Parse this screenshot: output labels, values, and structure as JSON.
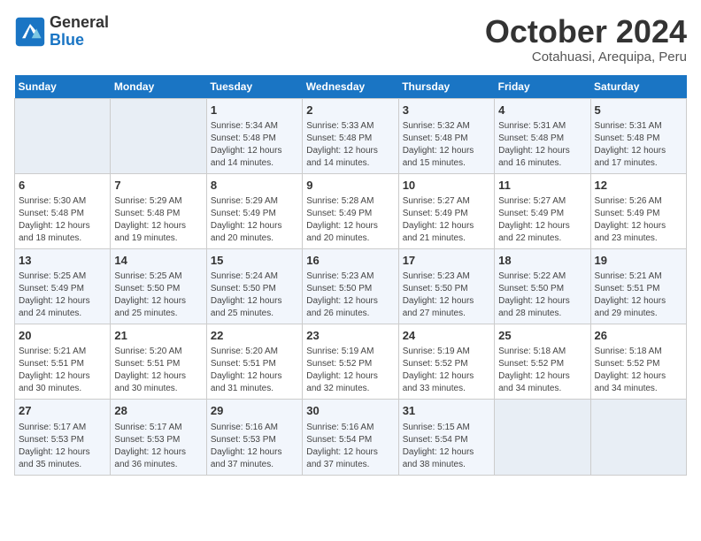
{
  "header": {
    "logo_line1": "General",
    "logo_line2": "Blue",
    "month": "October 2024",
    "location": "Cotahuasi, Arequipa, Peru"
  },
  "columns": [
    "Sunday",
    "Monday",
    "Tuesday",
    "Wednesday",
    "Thursday",
    "Friday",
    "Saturday"
  ],
  "weeks": [
    [
      {
        "num": "",
        "detail": ""
      },
      {
        "num": "",
        "detail": ""
      },
      {
        "num": "1",
        "detail": "Sunrise: 5:34 AM\nSunset: 5:48 PM\nDaylight: 12 hours\nand 14 minutes."
      },
      {
        "num": "2",
        "detail": "Sunrise: 5:33 AM\nSunset: 5:48 PM\nDaylight: 12 hours\nand 14 minutes."
      },
      {
        "num": "3",
        "detail": "Sunrise: 5:32 AM\nSunset: 5:48 PM\nDaylight: 12 hours\nand 15 minutes."
      },
      {
        "num": "4",
        "detail": "Sunrise: 5:31 AM\nSunset: 5:48 PM\nDaylight: 12 hours\nand 16 minutes."
      },
      {
        "num": "5",
        "detail": "Sunrise: 5:31 AM\nSunset: 5:48 PM\nDaylight: 12 hours\nand 17 minutes."
      }
    ],
    [
      {
        "num": "6",
        "detail": "Sunrise: 5:30 AM\nSunset: 5:48 PM\nDaylight: 12 hours\nand 18 minutes."
      },
      {
        "num": "7",
        "detail": "Sunrise: 5:29 AM\nSunset: 5:48 PM\nDaylight: 12 hours\nand 19 minutes."
      },
      {
        "num": "8",
        "detail": "Sunrise: 5:29 AM\nSunset: 5:49 PM\nDaylight: 12 hours\nand 20 minutes."
      },
      {
        "num": "9",
        "detail": "Sunrise: 5:28 AM\nSunset: 5:49 PM\nDaylight: 12 hours\nand 20 minutes."
      },
      {
        "num": "10",
        "detail": "Sunrise: 5:27 AM\nSunset: 5:49 PM\nDaylight: 12 hours\nand 21 minutes."
      },
      {
        "num": "11",
        "detail": "Sunrise: 5:27 AM\nSunset: 5:49 PM\nDaylight: 12 hours\nand 22 minutes."
      },
      {
        "num": "12",
        "detail": "Sunrise: 5:26 AM\nSunset: 5:49 PM\nDaylight: 12 hours\nand 23 minutes."
      }
    ],
    [
      {
        "num": "13",
        "detail": "Sunrise: 5:25 AM\nSunset: 5:49 PM\nDaylight: 12 hours\nand 24 minutes."
      },
      {
        "num": "14",
        "detail": "Sunrise: 5:25 AM\nSunset: 5:50 PM\nDaylight: 12 hours\nand 25 minutes."
      },
      {
        "num": "15",
        "detail": "Sunrise: 5:24 AM\nSunset: 5:50 PM\nDaylight: 12 hours\nand 25 minutes."
      },
      {
        "num": "16",
        "detail": "Sunrise: 5:23 AM\nSunset: 5:50 PM\nDaylight: 12 hours\nand 26 minutes."
      },
      {
        "num": "17",
        "detail": "Sunrise: 5:23 AM\nSunset: 5:50 PM\nDaylight: 12 hours\nand 27 minutes."
      },
      {
        "num": "18",
        "detail": "Sunrise: 5:22 AM\nSunset: 5:50 PM\nDaylight: 12 hours\nand 28 minutes."
      },
      {
        "num": "19",
        "detail": "Sunrise: 5:21 AM\nSunset: 5:51 PM\nDaylight: 12 hours\nand 29 minutes."
      }
    ],
    [
      {
        "num": "20",
        "detail": "Sunrise: 5:21 AM\nSunset: 5:51 PM\nDaylight: 12 hours\nand 30 minutes."
      },
      {
        "num": "21",
        "detail": "Sunrise: 5:20 AM\nSunset: 5:51 PM\nDaylight: 12 hours\nand 30 minutes."
      },
      {
        "num": "22",
        "detail": "Sunrise: 5:20 AM\nSunset: 5:51 PM\nDaylight: 12 hours\nand 31 minutes."
      },
      {
        "num": "23",
        "detail": "Sunrise: 5:19 AM\nSunset: 5:52 PM\nDaylight: 12 hours\nand 32 minutes."
      },
      {
        "num": "24",
        "detail": "Sunrise: 5:19 AM\nSunset: 5:52 PM\nDaylight: 12 hours\nand 33 minutes."
      },
      {
        "num": "25",
        "detail": "Sunrise: 5:18 AM\nSunset: 5:52 PM\nDaylight: 12 hours\nand 34 minutes."
      },
      {
        "num": "26",
        "detail": "Sunrise: 5:18 AM\nSunset: 5:52 PM\nDaylight: 12 hours\nand 34 minutes."
      }
    ],
    [
      {
        "num": "27",
        "detail": "Sunrise: 5:17 AM\nSunset: 5:53 PM\nDaylight: 12 hours\nand 35 minutes."
      },
      {
        "num": "28",
        "detail": "Sunrise: 5:17 AM\nSunset: 5:53 PM\nDaylight: 12 hours\nand 36 minutes."
      },
      {
        "num": "29",
        "detail": "Sunrise: 5:16 AM\nSunset: 5:53 PM\nDaylight: 12 hours\nand 37 minutes."
      },
      {
        "num": "30",
        "detail": "Sunrise: 5:16 AM\nSunset: 5:54 PM\nDaylight: 12 hours\nand 37 minutes."
      },
      {
        "num": "31",
        "detail": "Sunrise: 5:15 AM\nSunset: 5:54 PM\nDaylight: 12 hours\nand 38 minutes."
      },
      {
        "num": "",
        "detail": ""
      },
      {
        "num": "",
        "detail": ""
      }
    ]
  ]
}
